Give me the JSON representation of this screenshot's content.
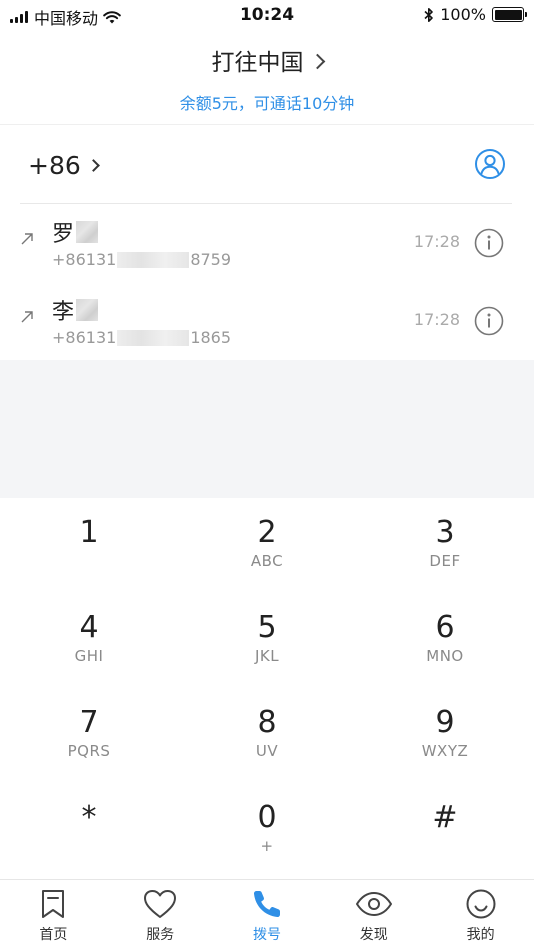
{
  "status_bar": {
    "carrier": "中国移动",
    "time": "10:24",
    "battery": "100%",
    "battery_level": 1.0
  },
  "header": {
    "title": "打往中国",
    "balance_text": "余额5元，可通话10分钟"
  },
  "dialer": {
    "country_code": "+86"
  },
  "recents": [
    {
      "name": "罗",
      "number_prefix": "+86131",
      "number_suffix": "8759",
      "time": "17:28",
      "direction": "outgoing"
    },
    {
      "name": "李",
      "number_prefix": "+86131",
      "number_suffix": "1865",
      "time": "17:28",
      "direction": "outgoing"
    }
  ],
  "keypad": [
    {
      "digit": "1",
      "letters": ""
    },
    {
      "digit": "2",
      "letters": "ABC"
    },
    {
      "digit": "3",
      "letters": "DEF"
    },
    {
      "digit": "4",
      "letters": "GHI"
    },
    {
      "digit": "5",
      "letters": "JKL"
    },
    {
      "digit": "6",
      "letters": "MNO"
    },
    {
      "digit": "7",
      "letters": "PQRS"
    },
    {
      "digit": "8",
      "letters": "UV"
    },
    {
      "digit": "9",
      "letters": "WXYZ"
    },
    {
      "digit": "*",
      "letters": ""
    },
    {
      "digit": "0",
      "letters": "+"
    },
    {
      "digit": "#",
      "letters": ""
    }
  ],
  "tabs": [
    {
      "label": "首页",
      "icon": "bookmark-icon",
      "active": false
    },
    {
      "label": "服务",
      "icon": "heart-icon",
      "active": false
    },
    {
      "label": "拨号",
      "icon": "phone-icon",
      "active": true
    },
    {
      "label": "发现",
      "icon": "eye-icon",
      "active": false
    },
    {
      "label": "我的",
      "icon": "smiley-icon",
      "active": false
    }
  ],
  "colors": {
    "accent": "#2f8fe6",
    "gray_area": "#f4f5f7"
  }
}
